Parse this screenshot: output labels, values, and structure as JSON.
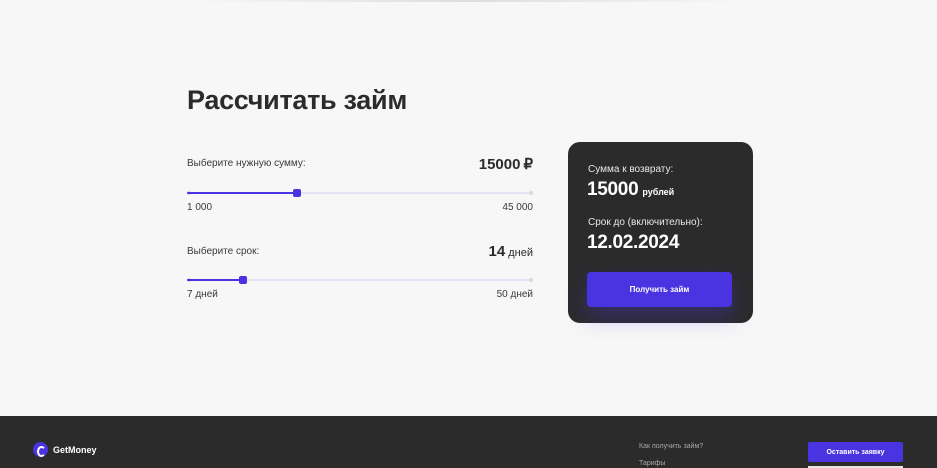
{
  "calculator": {
    "title": "Рассчитать займ",
    "amount": {
      "label": "Выберите нужную сумму:",
      "value": "15000",
      "currency": "₽",
      "min_label": "1 000",
      "max_label": "45 000",
      "min": 1000,
      "max": 45000,
      "current": 15000
    },
    "term": {
      "label": "Выберите срок:",
      "value": "14",
      "unit": "дней",
      "min_label": "7 дней",
      "max_label": "50 дней",
      "min": 7,
      "max": 50,
      "current": 14
    }
  },
  "summary": {
    "return_label": "Сумма к возврату:",
    "return_value": "15000",
    "return_unit": "рублей",
    "date_label": "Срок до (включительно):",
    "date_value": "12.02.2024",
    "cta_label": "Получить займ"
  },
  "footer": {
    "brand": "GetMoney",
    "links": [
      "Как получить займ?",
      "Тарифы"
    ],
    "cta_label": "Оставить заявку"
  },
  "colors": {
    "accent": "#4a33e0",
    "dark": "#2b2b2b",
    "background": "#f7f7f7"
  }
}
